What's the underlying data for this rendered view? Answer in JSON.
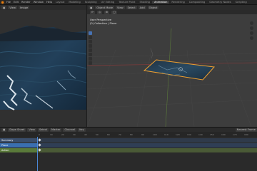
{
  "topbar": {
    "menus": [
      "File",
      "Edit",
      "Render",
      "Window",
      "Help"
    ],
    "workspaces": [
      "Layout",
      "Modeling",
      "Sculpting",
      "UV Editing",
      "Texture Paint",
      "Shading",
      "Animation",
      "Rendering",
      "Compositing",
      "Geometry Nodes",
      "Scripting"
    ],
    "active_workspace_index": 6
  },
  "image_editor": {
    "header_buttons": [
      "View",
      "Image"
    ]
  },
  "viewport": {
    "mode": "Object Mode",
    "menus": [
      "View",
      "Select",
      "Add",
      "Object"
    ],
    "info_line1": "User Perspective",
    "info_line2": "(0) Collection | Plane"
  },
  "dopesheet": {
    "editor": "Dope Sheet",
    "menus": [
      "View",
      "Select",
      "Marker",
      "Channel",
      "Key"
    ],
    "mode_right": "Nearest Frame",
    "ticks": [
      "0",
      "10",
      "20",
      "30",
      "40",
      "50",
      "60",
      "70",
      "80",
      "90",
      "100",
      "110",
      "120",
      "130",
      "140",
      "150",
      "160",
      "170",
      "180"
    ],
    "channels": [
      "Summary",
      "Plane",
      "Action"
    ],
    "colors": {
      "accent": "#e87d0d",
      "summary_row": "#3a4e6b",
      "object_row": "#3a6fb0",
      "action_row": "#5a7a3a",
      "selection_outline": "#f0a030"
    }
  }
}
